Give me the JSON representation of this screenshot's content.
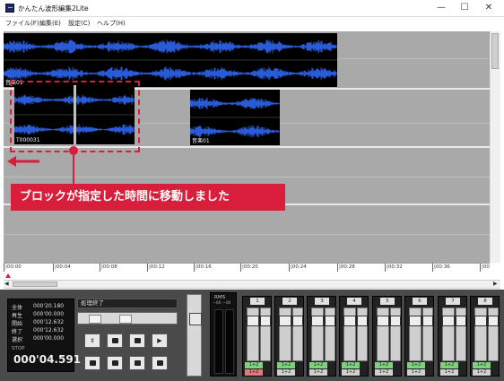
{
  "window": {
    "title": "かんたん波形編集2Lite",
    "minimize": "—",
    "maximize": "☐",
    "close": "✕"
  },
  "menu": [
    "ファイル(F)",
    "編集(E)",
    "設定(C)",
    "ヘルプ(H)"
  ],
  "clips": {
    "track1_label": "音楽01",
    "selected_label": "T000031",
    "track2_label": "音楽01"
  },
  "ruler": [
    "|00:00",
    "|00:04",
    "|00:08",
    "|00:12",
    "|00:16",
    "|00:20",
    "|00:24",
    "|00:28",
    "|00:32",
    "|00:36",
    "|00"
  ],
  "time_panel": {
    "rows": [
      {
        "label": "全体",
        "value": "000'20.180"
      },
      {
        "label": "再生",
        "value": "000'00.000"
      },
      {
        "label": "開始",
        "value": "000'12.632"
      },
      {
        "label": "終了",
        "value": "000'12.632"
      },
      {
        "label": "選択",
        "value": "000'00.000"
      }
    ],
    "state": "STOP",
    "current": "000'04.591"
  },
  "status": "処理終了",
  "vu": {
    "label": "RMS",
    "scale": "−00 −00"
  },
  "channels": [
    {
      "num": "1",
      "btn1": "1+2",
      "btn2": "1+2"
    },
    {
      "num": "2",
      "btn1": "1+2",
      "btn2": "1+2"
    },
    {
      "num": "3",
      "btn1": "1+2",
      "btn2": "1+2"
    },
    {
      "num": "4",
      "btn1": "1+2",
      "btn2": "1+2"
    },
    {
      "num": "5",
      "btn1": "1+2",
      "btn2": "1+2"
    },
    {
      "num": "6",
      "btn1": "1+2",
      "btn2": "1+2"
    },
    {
      "num": "7",
      "btn1": "1+2",
      "btn2": "1+2"
    },
    {
      "num": "8",
      "btn1": "1+2",
      "btn2": "1+2"
    }
  ],
  "callout": "ブロックが指定した時間に移動しました",
  "colors": {
    "wave": "#2a5bd7",
    "accent": "#d81e3a"
  }
}
